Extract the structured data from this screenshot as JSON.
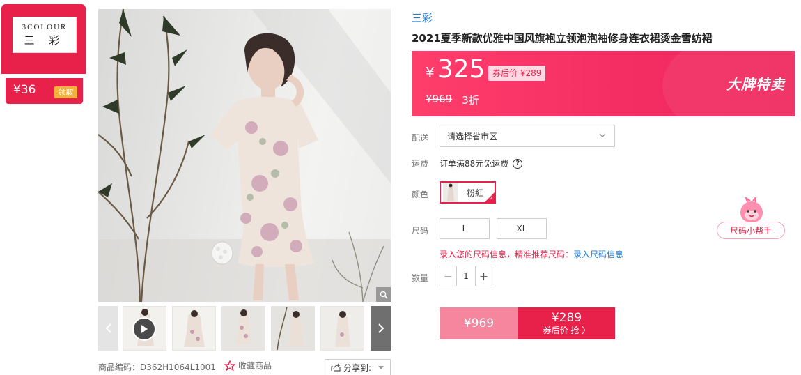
{
  "brand_card": {
    "logo_line1": "3COLOUR",
    "logo_line2": "三 彩",
    "coupon_amount": "¥36",
    "claim_label": "领取"
  },
  "gallery": {
    "thumbnails": [
      {
        "name": "video-thumb",
        "has_play": true
      },
      {
        "name": "thumb-2"
      },
      {
        "name": "thumb-3"
      },
      {
        "name": "thumb-4"
      },
      {
        "name": "thumb-5"
      }
    ]
  },
  "meta": {
    "sku": "商品编码：D362H1064L1001",
    "favorite_label": "收藏商品",
    "share_label": "分享到:"
  },
  "product": {
    "brand": "三彩",
    "title": "2021夏季新款优雅中国风旗袍立领泡泡袖修身连衣裙烫金雪纺裙"
  },
  "price": {
    "currency": "¥",
    "current": "325",
    "after_coupon": "券后价 ¥289",
    "original": "¥969",
    "discount": "3折",
    "promo_tag": "大牌特卖"
  },
  "delivery": {
    "label": "配送",
    "placeholder": "请选择省市区"
  },
  "shipping": {
    "label": "运费",
    "text": "订单满88元免运费"
  },
  "color": {
    "label": "颜色",
    "options": [
      "粉紅"
    ],
    "selected": "粉紅"
  },
  "size": {
    "label": "尺码",
    "options": [
      "L",
      "XL"
    ],
    "tip": "录入您的尺码信息，精准推荐尺码：",
    "tip_link": "录入尺码信息",
    "helper_label": "尺码小帮手"
  },
  "quantity": {
    "label": "数量",
    "value": "1"
  },
  "buy": {
    "original": "¥969",
    "price": "¥289",
    "action": "券后价 抢 〉"
  },
  "colors": {
    "accent": "#e8214a",
    "link": "#1a7cd8",
    "coupon_btn": "#f6b13a"
  }
}
